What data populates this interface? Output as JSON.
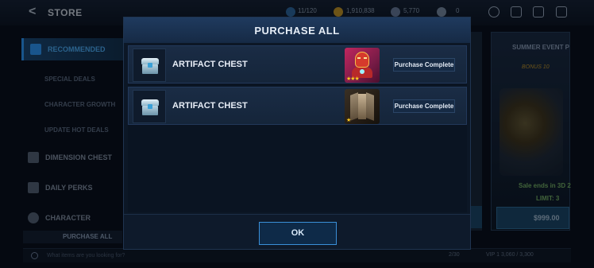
{
  "store": {
    "title": "STORE",
    "resources": [
      {
        "value": "11/120"
      },
      {
        "value": "1,910,838"
      },
      {
        "value": "5,770"
      },
      {
        "value": "0"
      }
    ],
    "sidebar": {
      "items": [
        {
          "label": "RECOMMENDED",
          "active": true
        },
        {
          "label": "SPECIAL DEALS"
        },
        {
          "label": "CHARACTER GROWTH"
        },
        {
          "label": "UPDATE HOT DEALS"
        },
        {
          "label": "DIMENSION CHEST"
        },
        {
          "label": "DAILY PERKS"
        },
        {
          "label": "CHARACTER"
        }
      ]
    },
    "purchase_all_label": "PURCHASE ALL",
    "search_placeholder": "What items are you looking for?",
    "bottom_info": {
      "count": "2/30",
      "vip": "VIP 1  3,060 / 3,300"
    },
    "event_card": {
      "title": "SUMMER EVENT P",
      "bonus": "BONUS 10",
      "sale_text": "Sale ends in 3D 2",
      "limit": "LIMIT: 3",
      "price": "$999.00"
    }
  },
  "modal": {
    "title": "PURCHASE ALL",
    "rows": [
      {
        "name": "ARTIFACT CHEST",
        "status": "Purchase Complete",
        "reward_stars": "★★★"
      },
      {
        "name": "ARTIFACT CHEST",
        "status": "Purchase Complete",
        "reward_stars": "★"
      }
    ],
    "ok_label": "OK"
  },
  "colors": {
    "accent": "#3a8fd8",
    "gold": "#ffcc1f"
  }
}
